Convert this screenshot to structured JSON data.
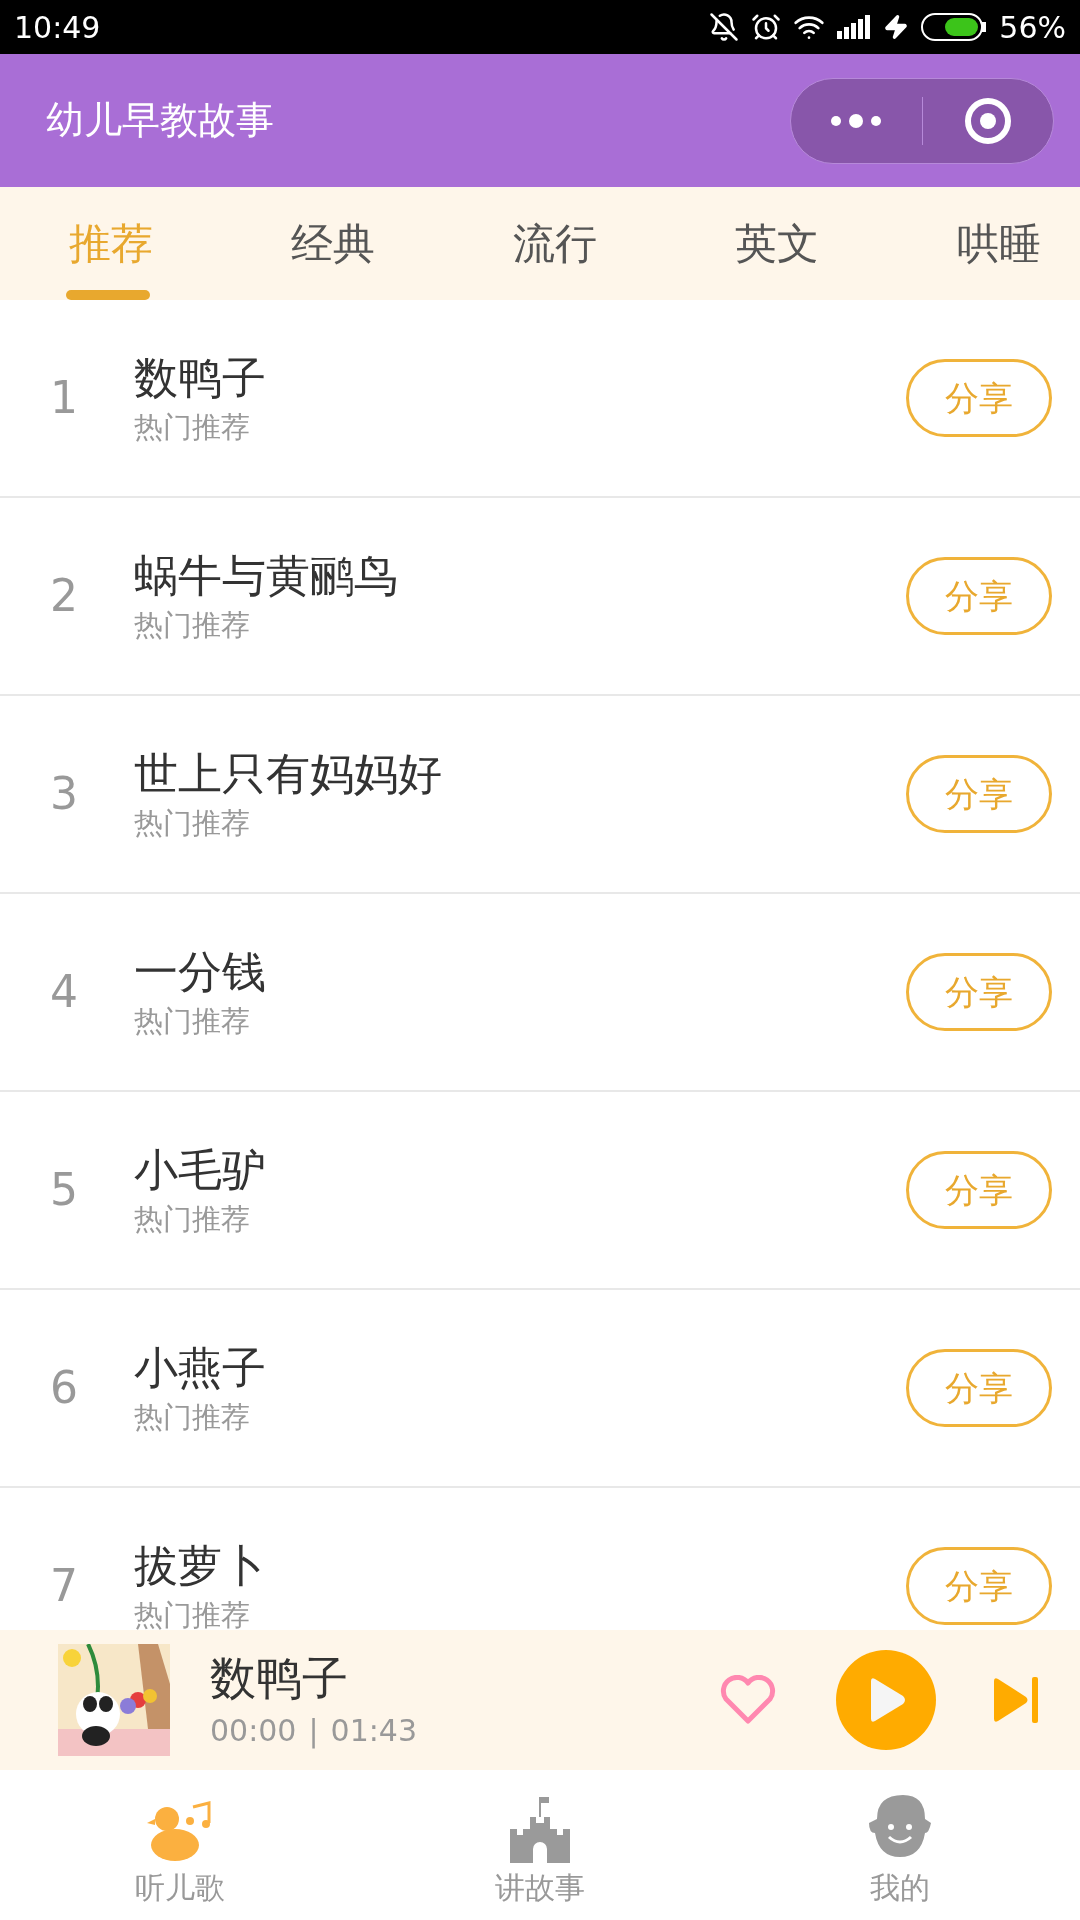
{
  "status_bar": {
    "time": "10:49",
    "battery": "56%"
  },
  "header": {
    "title": "幼儿早教故事"
  },
  "tabs": [
    {
      "label": "推荐",
      "selected": true
    },
    {
      "label": "经典",
      "selected": false
    },
    {
      "label": "流行",
      "selected": false
    },
    {
      "label": "英文",
      "selected": false
    },
    {
      "label": "哄睡",
      "selected": false
    }
  ],
  "songs": [
    {
      "number": "1",
      "title": "数鸭子",
      "subtitle": "热门推荐",
      "share": "分享"
    },
    {
      "number": "2",
      "title": "蜗牛与黄鹂鸟",
      "subtitle": "热门推荐",
      "share": "分享"
    },
    {
      "number": "3",
      "title": "世上只有妈妈好",
      "subtitle": "热门推荐",
      "share": "分享"
    },
    {
      "number": "4",
      "title": "一分钱",
      "subtitle": "热门推荐",
      "share": "分享"
    },
    {
      "number": "5",
      "title": "小毛驴",
      "subtitle": "热门推荐",
      "share": "分享"
    },
    {
      "number": "6",
      "title": "小燕子",
      "subtitle": "热门推荐",
      "share": "分享"
    },
    {
      "number": "7",
      "title": "拔萝卜",
      "subtitle": "热门推荐",
      "share": "分享"
    }
  ],
  "player": {
    "title": "数鸭子",
    "elapsed": "00:00",
    "separator": "|",
    "duration": "01:43",
    "liked": false
  },
  "nav": [
    {
      "label": "听儿歌",
      "kind": "duck",
      "selected": true
    },
    {
      "label": "讲故事",
      "kind": "castle",
      "selected": false
    },
    {
      "label": "我的",
      "kind": "face",
      "selected": false
    }
  ]
}
